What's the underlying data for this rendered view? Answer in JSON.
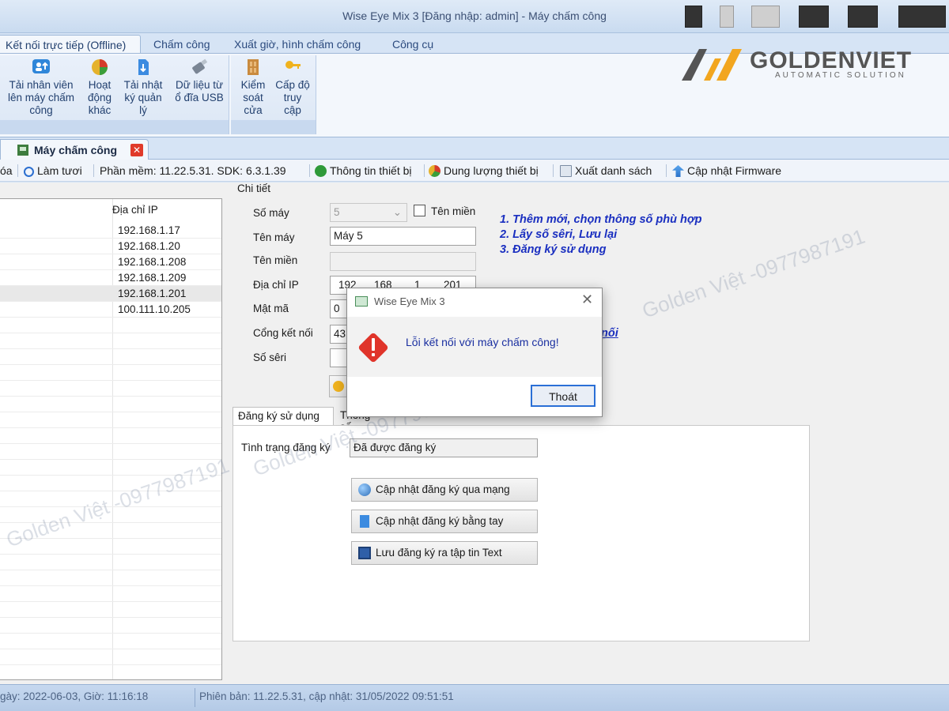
{
  "window": {
    "title": "Wise Eye Mix 3 [Đăng nhập: admin] - Máy chấm công"
  },
  "ribbon": {
    "tabs": [
      {
        "label": "Kết nối trực tiếp (Offline)",
        "active": true
      },
      {
        "label": "Chấm công"
      },
      {
        "label": "Xuất giờ, hình chấm công"
      },
      {
        "label": "Công cụ"
      }
    ],
    "buttons": {
      "upload_staff": {
        "l1": "Tải nhân viên",
        "l2": "lên máy chấm",
        "l3": "công"
      },
      "other_activity": {
        "l1": "Hoạt",
        "l2": "động",
        "l3": "khác"
      },
      "download_log": {
        "l1": "Tải nhật",
        "l2": "ký quản",
        "l3": "lý"
      },
      "usb_data": {
        "l1": "Dữ liệu từ",
        "l2": "ổ đĩa USB"
      },
      "door_control": {
        "l1": "Kiểm",
        "l2": "soát",
        "l3": "cửa"
      },
      "access_level": {
        "l1": "Cấp độ",
        "l2": "truy",
        "l3": "cập"
      }
    }
  },
  "logo": {
    "brand": "GOLDENVIET",
    "tagline": "AUTOMATIC SOLUTION"
  },
  "doc_tab": {
    "label": "Máy chấm công",
    "close": "✕"
  },
  "toolbar": {
    "delete_partial": "óa",
    "refresh": "Làm tươi",
    "software": "Phần mềm: 11.22.5.31. SDK: 6.3.1.39",
    "device_info": "Thông tin thiết bị",
    "capacity": "Dung lượng thiết bị",
    "export_list": "Xuất danh sách",
    "firmware": "Cập nhật Firmware"
  },
  "device_list": {
    "column_ip": "Địa chỉ IP",
    "rows": [
      "192.168.1.17",
      "192.168.1.20",
      "192.168.1.208",
      "192.168.1.209",
      "192.168.1.201",
      "100.111.10.205"
    ],
    "selected_index": 4
  },
  "detail": {
    "legend": "Chi tiết",
    "machine_no_label": "Số máy",
    "machine_no_value": "5",
    "domain_checkbox_label": "Tên miền",
    "machine_name_label": "Tên máy",
    "machine_name_value": "Máy 5",
    "domain_label": "Tên miền",
    "ip_label": "Địa chỉ IP",
    "ip_parts": [
      "192",
      "168",
      "1",
      "201"
    ],
    "password_label": "Mật mã",
    "password_value": "0",
    "port_label": "Cổng kết nối",
    "port_value": "43",
    "serial_label": "Số sêri",
    "instructions": [
      "1. Thêm mới, chọn thông số phù hợp",
      "2. Lấy số sêri, Lưu lại",
      "3. Đăng ký sử dụng"
    ],
    "link_partial": "nối"
  },
  "subtabs": {
    "tabs": [
      {
        "label": "Đăng ký sử dụng",
        "active": true
      },
      {
        "label": "Thông số"
      }
    ],
    "status_label": "Tình trạng đăng ký",
    "status_value": "Đã được đăng ký",
    "buttons": [
      "Cập nhật đăng ký qua mạng",
      "Cập nhật đăng ký bằng tay",
      "Lưu đăng ký ra tập tin Text"
    ]
  },
  "dialog": {
    "title": "Wise Eye Mix 3",
    "message": "Lỗi kết nối với máy chấm công!",
    "ok": "Thoát",
    "close": "✕"
  },
  "watermark": "Golden Việt -0977987191",
  "statusbar": {
    "date": "gày: 2022-06-03, Giờ: 11:16:18",
    "version": "Phiên bản: 11.22.5.31, cập nhật: 31/05/2022 09:51:51"
  },
  "colors": {
    "accent": "#2b4a7e",
    "instruction": "#1a2fc0",
    "error": "#e0342a"
  }
}
